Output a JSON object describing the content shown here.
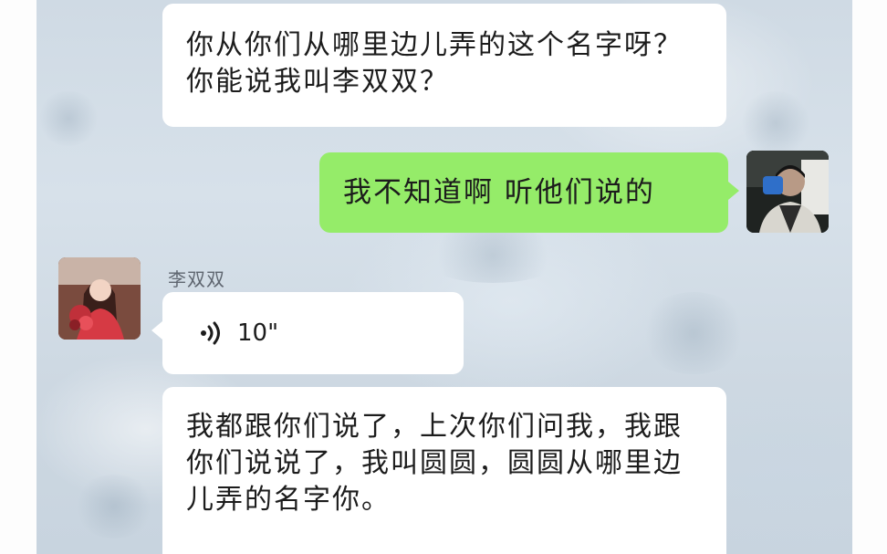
{
  "messages": [
    {
      "side": "left",
      "type": "text",
      "text": "你从你们从哪里边儿弄的这个名字呀？你能说我叫李双双？"
    },
    {
      "side": "right",
      "type": "text",
      "text": "我不知道啊 听他们说的"
    },
    {
      "side": "left",
      "type": "voice",
      "sender": "李双双",
      "duration": "10\""
    },
    {
      "side": "left",
      "type": "text",
      "text": "我都跟你们说了，上次你们问我，我跟你们说说了，我叫圆圆，圆圆从哪里边儿弄的名字你。"
    }
  ],
  "colors": {
    "bubble_white": "#ffffff",
    "bubble_green": "#95ec69"
  },
  "icons": {
    "voice": "sound-wave-icon"
  }
}
